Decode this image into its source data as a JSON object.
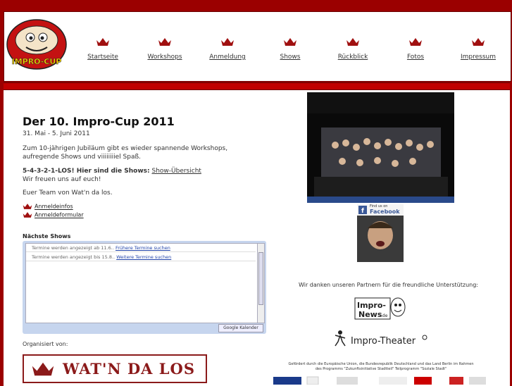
{
  "site": {
    "logo_text": "IMPRO-CUP"
  },
  "nav": [
    {
      "label": "Startseite"
    },
    {
      "label": "Workshops"
    },
    {
      "label": "Anmeldung"
    },
    {
      "label": "Shows"
    },
    {
      "label": "Rückblick"
    },
    {
      "label": "Fotos"
    },
    {
      "label": "Impressum"
    }
  ],
  "main": {
    "title": "Der 10. Impro-Cup 2011",
    "date": "31. Mai - 5. Juni 2011",
    "intro": "Zum 10-jährigen Jubiläum gibt es wieder spannende Workshops, aufregende Shows und viiiiiiiiel Spaß.",
    "shows_bold": "5-4-3-2-1-LOS! Hier sind die Shows:",
    "shows_link": "Show-Übersicht",
    "shows_line2": "Wir freuen uns auf euch!",
    "team": "Euer Team von Wat'n da los.",
    "links": [
      "Anmeldeinfos",
      "Anmeldeformular"
    ],
    "next_shows_heading": "Nächste Shows",
    "calendar": {
      "rows": [
        {
          "text": "Termine werden angezeigt ab 11.6..",
          "link": "Frühere Termine suchen"
        },
        {
          "text": "Termine werden angezeigt bis 15.8..",
          "link": "Weitere Termine suchen"
        }
      ],
      "badge": "Google Kalender"
    },
    "organized_by": "Organisiert von:",
    "organizer_logo_text": "WAT'N DA LOS"
  },
  "side": {
    "facebook_label_1": "Find us on",
    "facebook_label_2": "Facebook",
    "thanks": "Wir danken unseren Partnern für die freundliche Unterstützung:",
    "partner1": "Impro-News.de",
    "partner2": "Impro-Theater",
    "footer_line1": "Gefördert durch die Europäische Union, die Bundesrepublik Deutschland und das Land Berlin im Rahmen",
    "footer_line2": "des Programms \"Zukunftsinitiative Stadtteil\" Teilprogramm \"Soziale Stadt\""
  },
  "colors": {
    "brand_red": "#9b0000",
    "accent_red": "#c00000",
    "link_blue": "#2244aa"
  }
}
